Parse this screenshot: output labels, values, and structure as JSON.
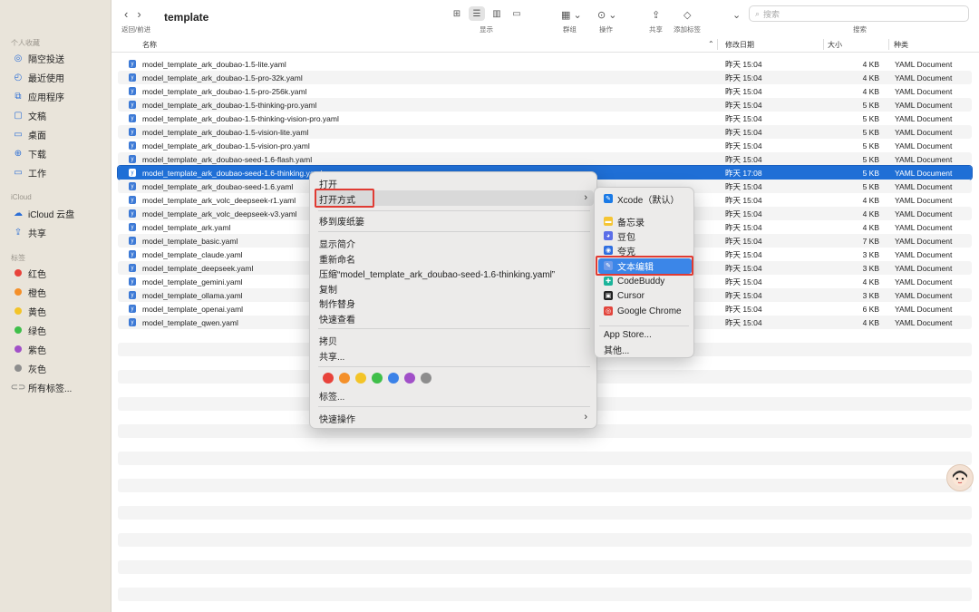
{
  "sidebar": {
    "favorites_label": "个人收藏",
    "favorites": [
      {
        "label": "隔空投送",
        "icon": "airdrop-icon"
      },
      {
        "label": "最近使用",
        "icon": "clock-icon"
      },
      {
        "label": "应用程序",
        "icon": "applications-icon"
      },
      {
        "label": "文稿",
        "icon": "document-icon"
      },
      {
        "label": "桌面",
        "icon": "desktop-icon"
      },
      {
        "label": "下载",
        "icon": "download-icon"
      },
      {
        "label": "工作",
        "icon": "folder-icon"
      }
    ],
    "icloud_label": "iCloud",
    "icloud": [
      {
        "label": "iCloud 云盘",
        "icon": "cloud-icon"
      },
      {
        "label": "共享",
        "icon": "shared-folder-icon"
      }
    ],
    "tags_label": "标签",
    "tags": [
      {
        "label": "红色",
        "color": "#e8433b"
      },
      {
        "label": "橙色",
        "color": "#f4902a"
      },
      {
        "label": "黄色",
        "color": "#f3c428"
      },
      {
        "label": "绿色",
        "color": "#3fbf4a"
      },
      {
        "label": "紫色",
        "color": "#a150c8"
      },
      {
        "label": "灰色",
        "color": "#8d8d8d"
      },
      {
        "label": "所有标签...",
        "color": ""
      }
    ]
  },
  "toolbar": {
    "back_forward_label": "返回/前进",
    "title": "template",
    "view_label": "显示",
    "group_label": "群组",
    "action_label": "操作",
    "share_label": "共享",
    "add_tag_label": "添加标签",
    "search_label": "搜索",
    "search_placeholder": "搜索"
  },
  "columns": {
    "name": "名称",
    "date": "修改日期",
    "size": "大小",
    "kind": "种类"
  },
  "files": [
    {
      "name": "model_template_ark_doubao-1.5-lite.yaml",
      "date": "昨天 15:04",
      "size": "4 KB",
      "kind": "YAML Document"
    },
    {
      "name": "model_template_ark_doubao-1.5-pro-32k.yaml",
      "date": "昨天 15:04",
      "size": "4 KB",
      "kind": "YAML Document"
    },
    {
      "name": "model_template_ark_doubao-1.5-pro-256k.yaml",
      "date": "昨天 15:04",
      "size": "4 KB",
      "kind": "YAML Document"
    },
    {
      "name": "model_template_ark_doubao-1.5-thinking-pro.yaml",
      "date": "昨天 15:04",
      "size": "5 KB",
      "kind": "YAML Document"
    },
    {
      "name": "model_template_ark_doubao-1.5-thinking-vision-pro.yaml",
      "date": "昨天 15:04",
      "size": "5 KB",
      "kind": "YAML Document"
    },
    {
      "name": "model_template_ark_doubao-1.5-vision-lite.yaml",
      "date": "昨天 15:04",
      "size": "5 KB",
      "kind": "YAML Document"
    },
    {
      "name": "model_template_ark_doubao-1.5-vision-pro.yaml",
      "date": "昨天 15:04",
      "size": "5 KB",
      "kind": "YAML Document"
    },
    {
      "name": "model_template_ark_doubao-seed-1.6-flash.yaml",
      "date": "昨天 15:04",
      "size": "5 KB",
      "kind": "YAML Document"
    },
    {
      "name": "model_template_ark_doubao-seed-1.6-thinking.yaml",
      "date": "昨天 17:08",
      "size": "5 KB",
      "kind": "YAML Document"
    },
    {
      "name": "model_template_ark_doubao-seed-1.6.yaml",
      "date": "昨天 15:04",
      "size": "5 KB",
      "kind": "YAML Document"
    },
    {
      "name": "model_template_ark_volc_deepseek-r1.yaml",
      "date": "昨天 15:04",
      "size": "4 KB",
      "kind": "YAML Document"
    },
    {
      "name": "model_template_ark_volc_deepseek-v3.yaml",
      "date": "昨天 15:04",
      "size": "4 KB",
      "kind": "YAML Document"
    },
    {
      "name": "model_template_ark.yaml",
      "date": "昨天 15:04",
      "size": "4 KB",
      "kind": "YAML Document"
    },
    {
      "name": "model_template_basic.yaml",
      "date": "昨天 15:04",
      "size": "7 KB",
      "kind": "YAML Document"
    },
    {
      "name": "model_template_claude.yaml",
      "date": "昨天 15:04",
      "size": "3 KB",
      "kind": "YAML Document"
    },
    {
      "name": "model_template_deepseek.yaml",
      "date": "昨天 15:04",
      "size": "3 KB",
      "kind": "YAML Document"
    },
    {
      "name": "model_template_gemini.yaml",
      "date": "昨天 15:04",
      "size": "4 KB",
      "kind": "YAML Document"
    },
    {
      "name": "model_template_ollama.yaml",
      "date": "昨天 15:04",
      "size": "3 KB",
      "kind": "YAML Document"
    },
    {
      "name": "model_template_openai.yaml",
      "date": "昨天 15:04",
      "size": "6 KB",
      "kind": "YAML Document"
    },
    {
      "name": "model_template_qwen.yaml",
      "date": "昨天 15:04",
      "size": "4 KB",
      "kind": "YAML Document"
    }
  ],
  "selected_file_index": 8,
  "context_menu": {
    "open": "打开",
    "open_with": "打开方式",
    "move_to_trash": "移到废纸篓",
    "get_info": "显示简介",
    "rename": "重新命名",
    "compress": "压缩“model_template_ark_doubao-seed-1.6-thinking.yaml”",
    "duplicate": "复制",
    "make_alias": "制作替身",
    "quick_look": "快速查看",
    "copy": "拷贝",
    "share": "共享...",
    "tag_colors": [
      "#e8433b",
      "#f4902a",
      "#f3c428",
      "#3fbf4a",
      "#3b82e8",
      "#a150c8",
      "#8d8d8d"
    ],
    "tags": "标签...",
    "quick_actions": "快速操作"
  },
  "open_with_menu": {
    "apps": [
      {
        "label": "Xcode（默认）",
        "icon": "xcode-icon",
        "color": "#1a7ae6"
      },
      {
        "label": "备忘录",
        "icon": "notes-icon",
        "color": "#f5c533"
      },
      {
        "label": "豆包",
        "icon": "doubao-icon",
        "color": "#5b6ee8"
      },
      {
        "label": "夸克",
        "icon": "quark-icon",
        "color": "#2f6fe0"
      },
      {
        "label": "文本编辑",
        "icon": "textedit-icon",
        "color": "#6f9be8"
      },
      {
        "label": "CodeBuddy",
        "icon": "codebuddy-icon",
        "color": "#1bb49a"
      },
      {
        "label": "Cursor",
        "icon": "cursor-icon",
        "color": "#222222"
      },
      {
        "label": "Google Chrome",
        "icon": "chrome-icon",
        "color": "#e2453c"
      }
    ],
    "highlighted_index": 4,
    "app_store": "App Store...",
    "other": "其他..."
  },
  "colors": {
    "selection": "#1f6fd6",
    "highlight_box": "#e03b33",
    "menu_highlight": "#3b86e8"
  }
}
